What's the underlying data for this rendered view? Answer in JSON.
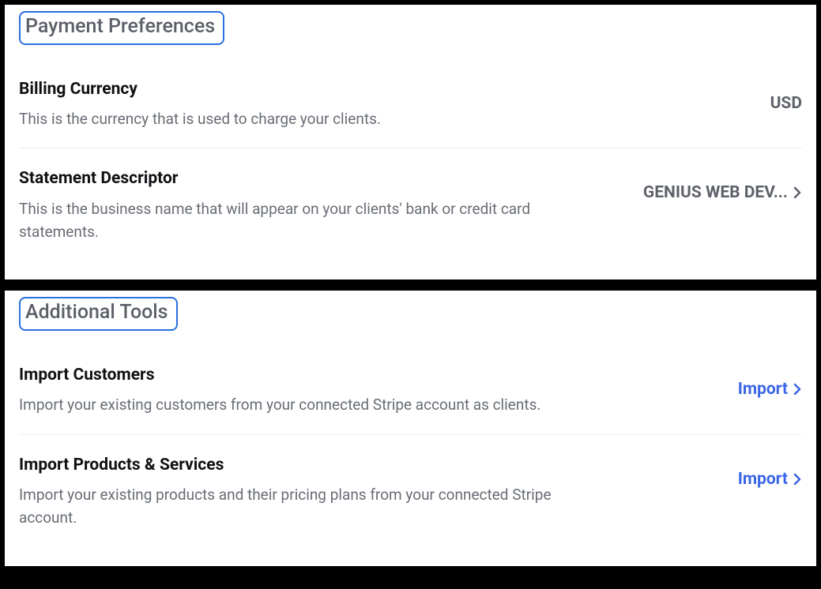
{
  "payment_preferences": {
    "heading": "Payment Preferences",
    "rows": {
      "billing_currency": {
        "title": "Billing Currency",
        "desc": "This is the currency that is used to charge your clients.",
        "value": "USD"
      },
      "statement_descriptor": {
        "title": "Statement Descriptor",
        "desc": "This is the business name that will appear on your clients' bank or credit card statements.",
        "value": "GENIUS WEB DEV..."
      }
    }
  },
  "additional_tools": {
    "heading": "Additional Tools",
    "rows": {
      "import_customers": {
        "title": "Import Customers",
        "desc": "Import your existing customers from your connected Stripe account as clients.",
        "action": "Import"
      },
      "import_products": {
        "title": "Import Products & Services",
        "desc": "Import your existing products and their pricing plans from your connected Stripe account.",
        "action": "Import"
      }
    }
  }
}
